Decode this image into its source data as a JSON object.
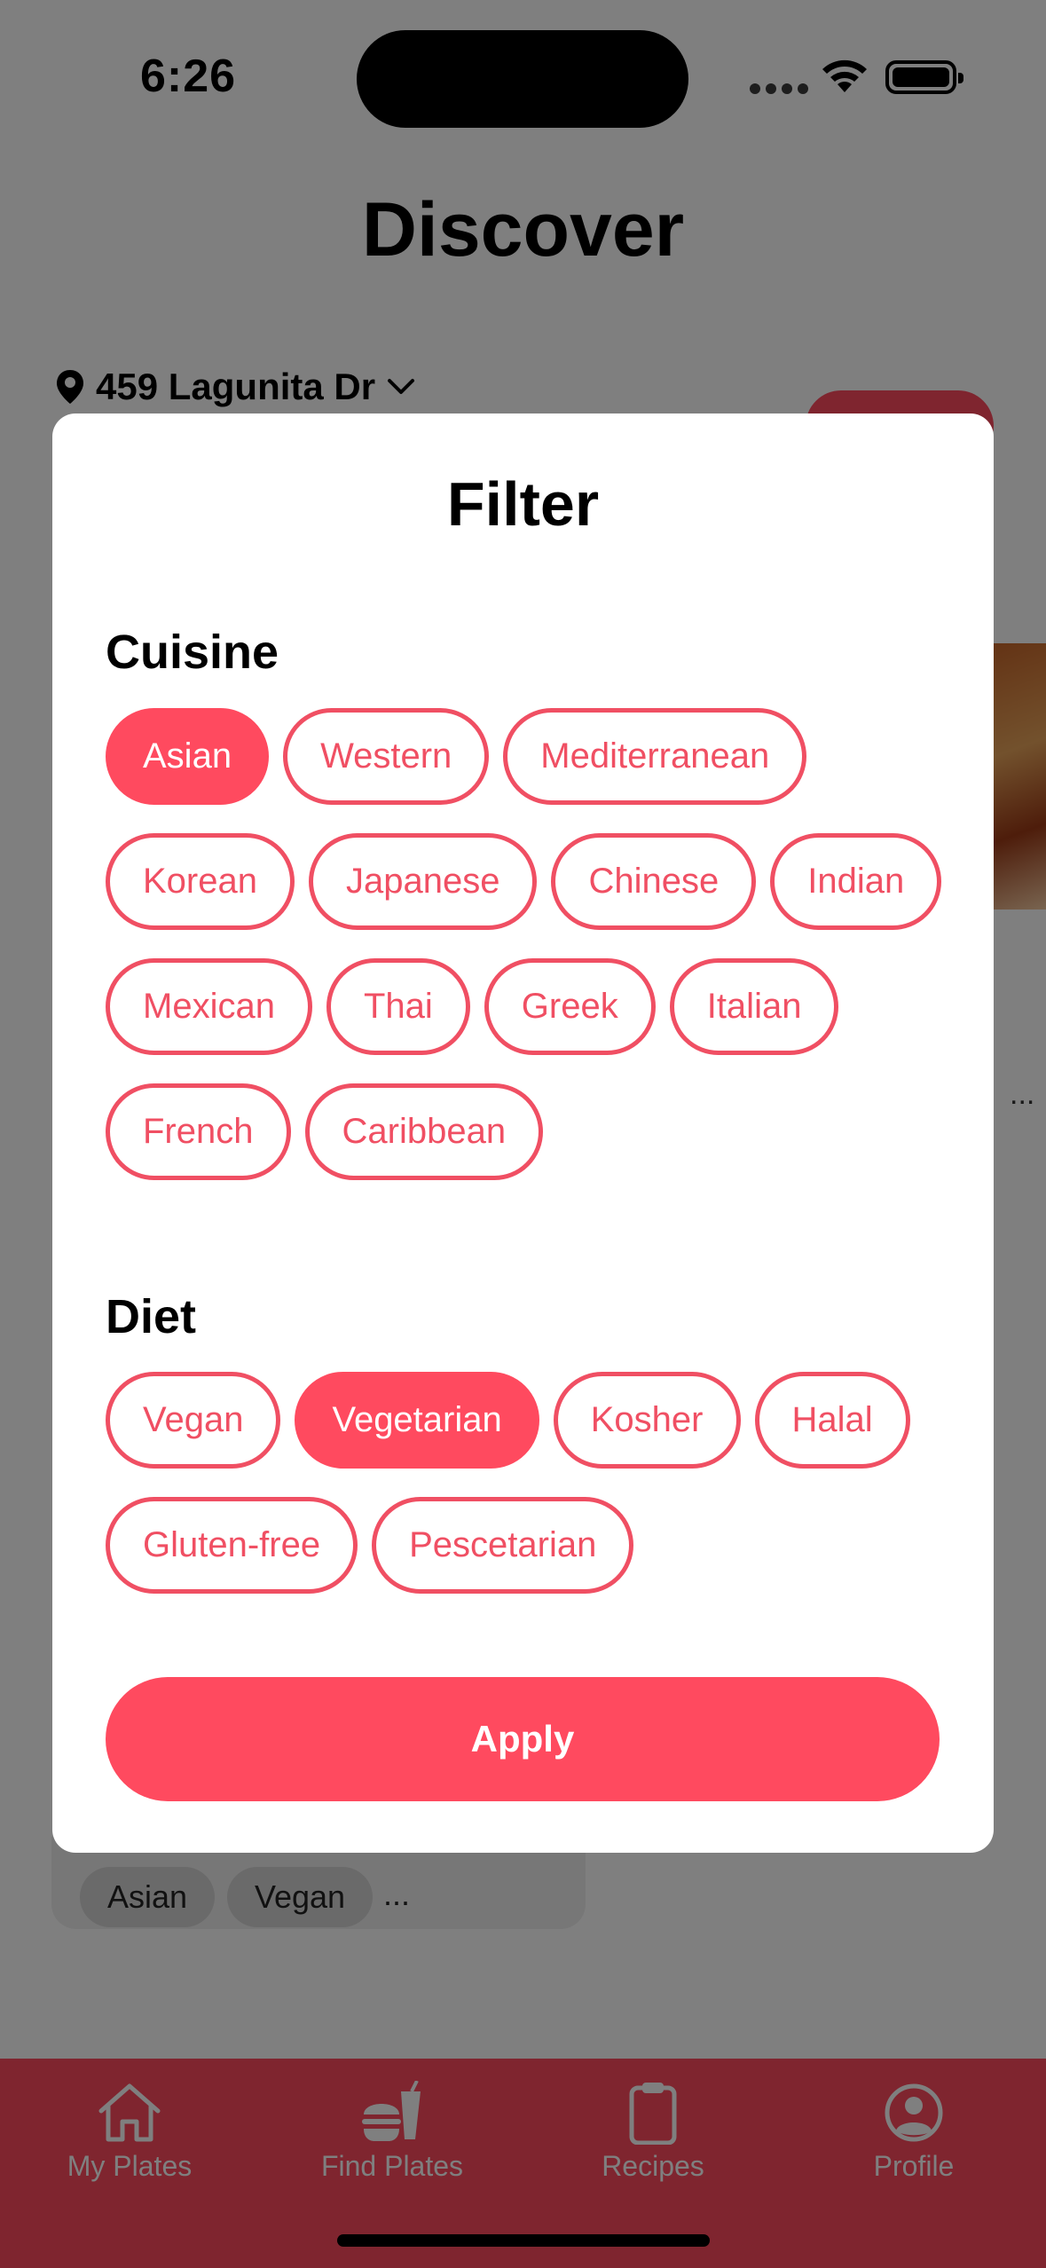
{
  "status_bar": {
    "time": "6:26"
  },
  "header": {
    "title": "Discover"
  },
  "location": {
    "address": "459 Lagunita Dr"
  },
  "background_card": {
    "tags": [
      "Asian",
      "Vegan"
    ],
    "more": "..."
  },
  "background_more": "...",
  "filter_modal": {
    "title": "Filter",
    "cuisine": {
      "title": "Cuisine",
      "options": [
        {
          "label": "Asian",
          "selected": true
        },
        {
          "label": "Western",
          "selected": false
        },
        {
          "label": "Mediterranean",
          "selected": false
        },
        {
          "label": "Korean",
          "selected": false
        },
        {
          "label": "Japanese",
          "selected": false
        },
        {
          "label": "Chinese",
          "selected": false
        },
        {
          "label": "Indian",
          "selected": false
        },
        {
          "label": "Mexican",
          "selected": false
        },
        {
          "label": "Thai",
          "selected": false
        },
        {
          "label": "Greek",
          "selected": false
        },
        {
          "label": "Italian",
          "selected": false
        },
        {
          "label": "French",
          "selected": false
        },
        {
          "label": "Caribbean",
          "selected": false
        }
      ]
    },
    "diet": {
      "title": "Diet",
      "options": [
        {
          "label": "Vegan",
          "selected": false
        },
        {
          "label": "Vegetarian",
          "selected": true
        },
        {
          "label": "Kosher",
          "selected": false
        },
        {
          "label": "Halal",
          "selected": false
        },
        {
          "label": "Gluten-free",
          "selected": false
        },
        {
          "label": "Pescetarian",
          "selected": false
        }
      ]
    },
    "apply_label": "Apply"
  },
  "tab_bar": {
    "tabs": [
      {
        "label": "My Plates",
        "icon": "house-icon"
      },
      {
        "label": "Find Plates",
        "icon": "burger-drink-icon"
      },
      {
        "label": "Recipes",
        "icon": "clipboard-icon"
      },
      {
        "label": "Profile",
        "icon": "person-circle-icon"
      }
    ]
  },
  "colors": {
    "accent": "#ff4a5f",
    "chip_outline": "#f04f63"
  }
}
